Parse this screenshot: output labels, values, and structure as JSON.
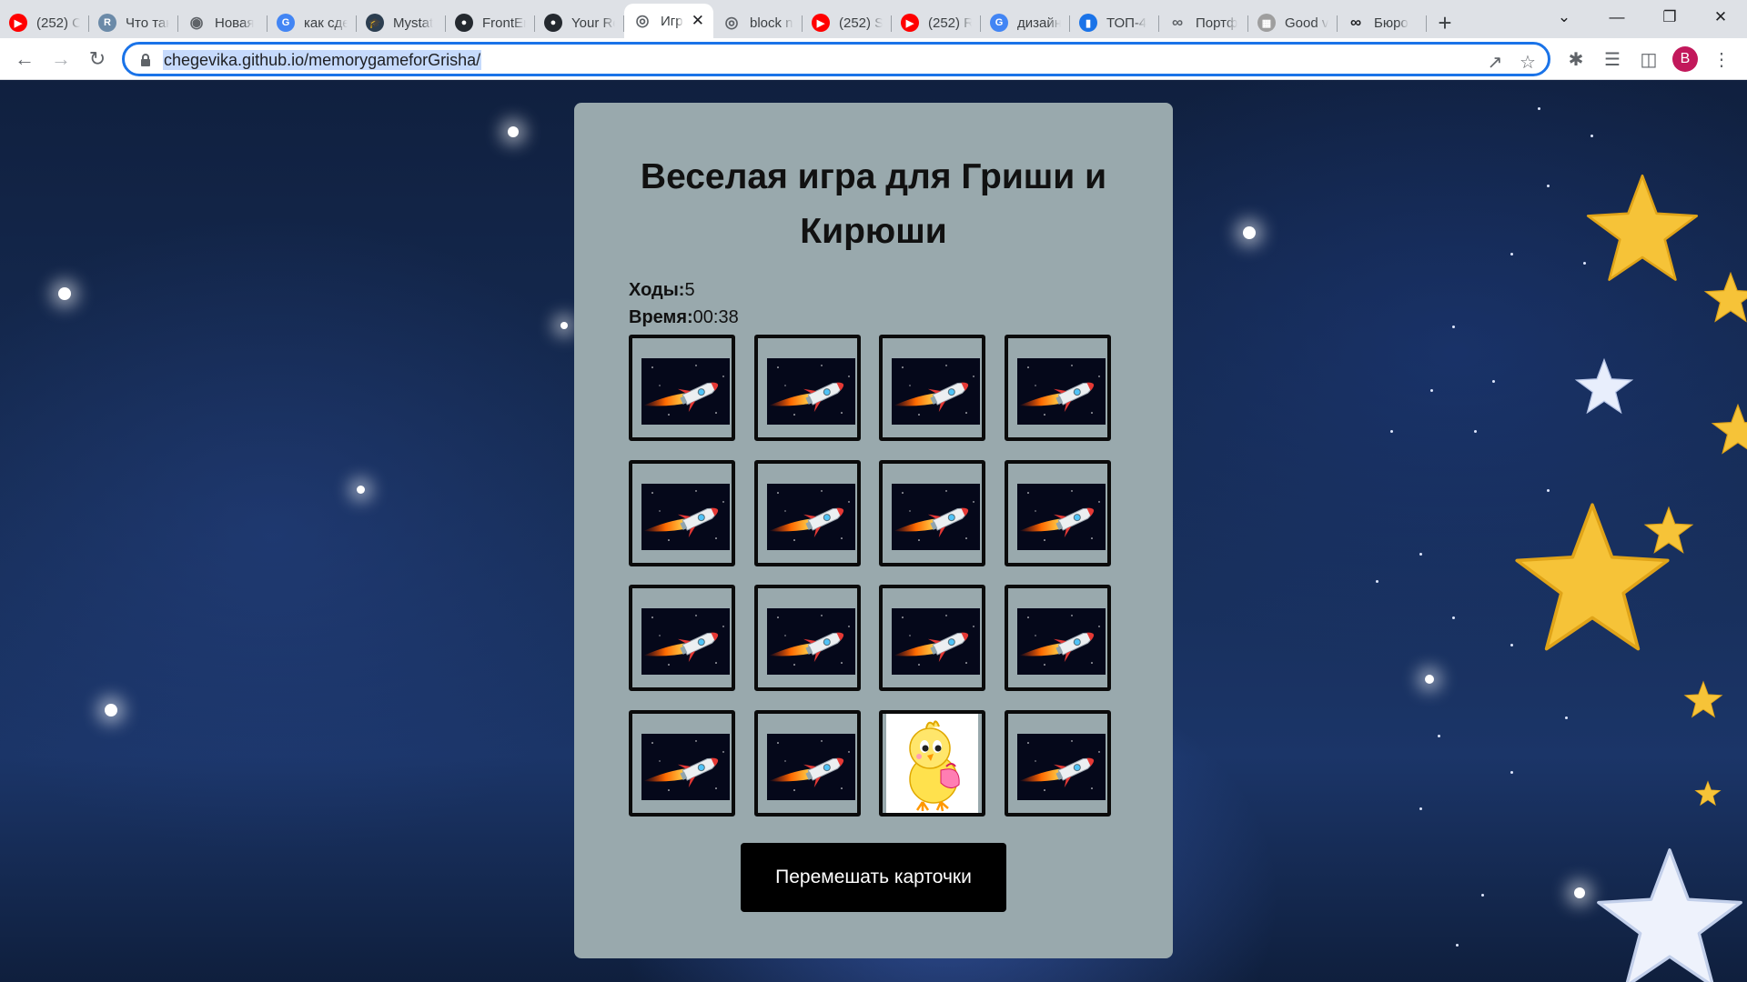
{
  "browser": {
    "tabs": [
      {
        "label": "(252) C",
        "icon": "youtube-icon",
        "color": "#ff0000"
      },
      {
        "label": "Что так",
        "icon": "r-logo-icon",
        "color": "#6b8aa8"
      },
      {
        "label": "Новая",
        "icon": "chrome-icon",
        "color": "#5f6368"
      },
      {
        "label": "как сде",
        "icon": "google-icon",
        "color": "#4285f4"
      },
      {
        "label": "Mystat",
        "icon": "mortarboard-icon",
        "color": "#2c3e50"
      },
      {
        "label": "FrontEr",
        "icon": "github-icon",
        "color": "#24292f"
      },
      {
        "label": "Your Re",
        "icon": "github-icon",
        "color": "#24292f"
      },
      {
        "label": "Игр",
        "icon": "globe-icon",
        "color": "#5f6368",
        "active": true
      },
      {
        "label": "block n",
        "icon": "globe-icon",
        "color": "#5f6368"
      },
      {
        "label": "(252) S",
        "icon": "youtube-icon",
        "color": "#ff0000"
      },
      {
        "label": "(252) R",
        "icon": "youtube-icon",
        "color": "#ff0000"
      },
      {
        "label": "дизайн",
        "icon": "google-icon",
        "color": "#4285f4"
      },
      {
        "label": "ТОП-4",
        "icon": "chart-icon",
        "color": "#1a73e8"
      },
      {
        "label": "Портф",
        "icon": "behance-icon",
        "color": "#5f6368"
      },
      {
        "label": "Good v",
        "icon": "site-icon",
        "color": "#9e9e9e"
      },
      {
        "label": "Бюро",
        "icon": "infinity-icon",
        "color": "#202124"
      }
    ],
    "url": "chegevika.github.io/memorygameforGrisha/",
    "profile_initial": "B"
  },
  "game": {
    "title": "Веселая игра для Гриши и Кирюши",
    "moves_label": "Ходы:",
    "moves_value": "5",
    "time_label": "Время:",
    "time_value": "00:38",
    "cards": [
      "rocket",
      "rocket",
      "rocket",
      "rocket",
      "rocket",
      "rocket",
      "rocket",
      "rocket",
      "rocket",
      "rocket",
      "rocket",
      "rocket",
      "rocket",
      "rocket",
      "chick",
      "rocket"
    ],
    "shuffle_label": "Перемешать карточки"
  },
  "colors": {
    "panel": "#99a9ad",
    "button": "#000000",
    "accent_omnibox": "#1a73e8"
  }
}
